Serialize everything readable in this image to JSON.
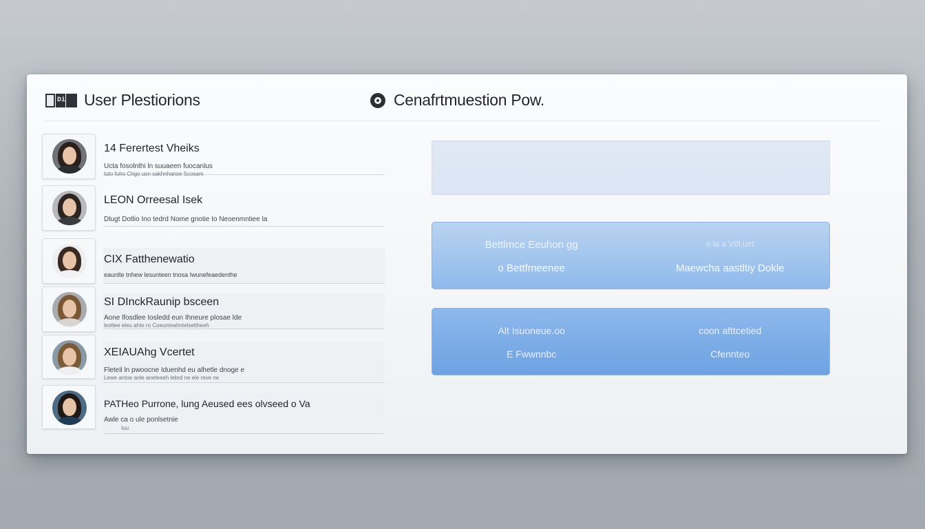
{
  "header": {
    "logo_text": [
      "",
      "DiK",
      ""
    ],
    "title": "User Plestiorions",
    "right_title": "Cenafrtmuestion Pow."
  },
  "users": [
    {
      "name": "14 Ferertest Vheiks",
      "desc": "Ucta fosolnthi ln suuaeen fuocanlus",
      "desc2": "tuto fuho Chgo uon sakhnhanse Scosam",
      "avatar": {
        "bg": "#6f7378",
        "hair": "#2a1f1a",
        "body": "#2b2c30"
      }
    },
    {
      "name": "LEON Orreesal Isek",
      "desc": "Dlugt Dotlio Ino tedrd Nome gnotie Io Neoenmntiee la",
      "desc2": "",
      "avatar": {
        "bg": "#b7b9bc",
        "hair": "#2c2420",
        "body": "#3a3b3f"
      }
    },
    {
      "name": "CIX Fatthenewatio",
      "desc": "eaunlte tnhew lesunteen tnosa Iwunefeaedenthe",
      "desc2": "",
      "avatar": {
        "bg": "#eceef0",
        "hair": "#3a2a22",
        "body": "#f2f2f2"
      }
    },
    {
      "name": "SI DInckRaunip bsceen",
      "desc": "Aone lfosdlee Iosledd eun Ihneure plosae lde",
      "desc2": "lesttee eleu ahte ro Coeunteahntelsettheeh",
      "avatar": {
        "bg": "#a9abae",
        "hair": "#7a5536",
        "body": "#d9d4cf"
      }
    },
    {
      "name": "XEIAUAhg Vcertet",
      "desc": "Fleteil ln pwoocne Iduenhd eu alhetle dnoge e",
      "desc2": "Lewe antoe anle aneteeeh lebrd ne ele reve ne",
      "avatar": {
        "bg": "#8a99a6",
        "hair": "#7b5a38",
        "body": "#efefef"
      }
    },
    {
      "name": "PATHeo Purrone, lung Aeused ees olvseed o Va",
      "desc": "Awle ca o ule ponlsetnie",
      "desc2": "Iuu",
      "avatar": {
        "bg": "#4f6b84",
        "hair": "#1f1814",
        "body": "#1f3b56"
      }
    }
  ],
  "panels": {
    "card1": {
      "left_l1": "Bettlmce Eeuhon gg",
      "left_l2": "o  Bettfmeenee",
      "right_l1": "o la a Vdl.uet",
      "right_l2": "Maewcha aastltiy Dokle"
    },
    "card2": {
      "left_l1": "Alt Isuoneue.oo",
      "left_l2": "E Fwwnnbc",
      "right_l1": "coon afttcetied",
      "right_l2": "Cfennteo"
    }
  },
  "colors": {
    "accent": "#7aa8e4",
    "window_bg": "#f4f6f8",
    "page_bg": "#aeb4ba"
  }
}
